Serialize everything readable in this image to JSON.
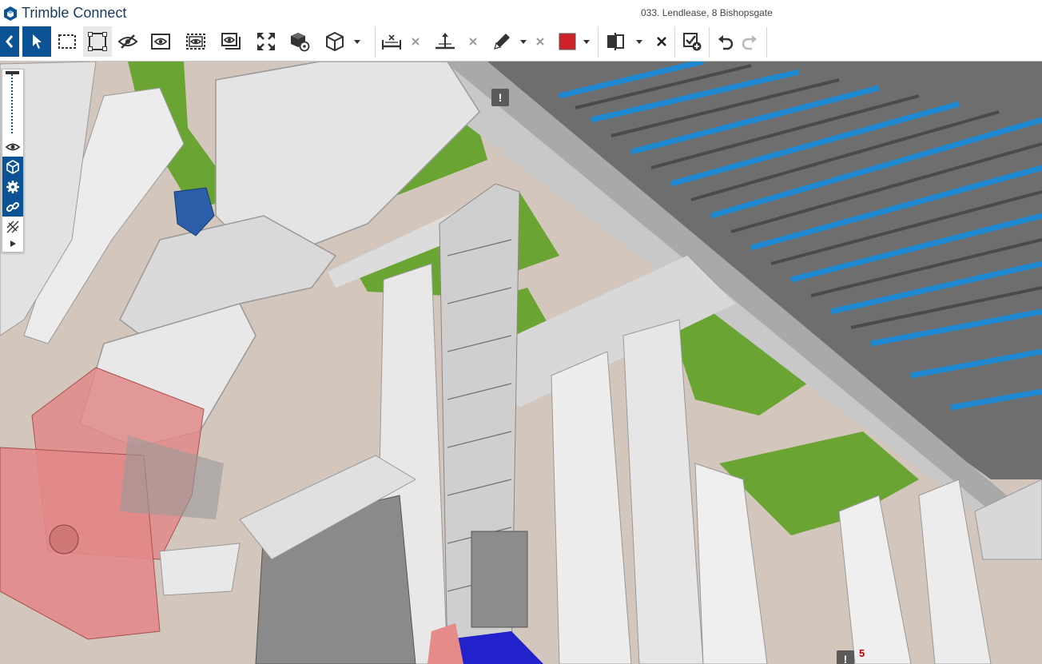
{
  "app": {
    "name": "Trimble Connect",
    "project_title": "033. Lendlease, 8 Bishopsgate"
  },
  "toolbar": {
    "buttons": [
      {
        "id": "back",
        "icon": "chevron-left-icon"
      },
      {
        "id": "select",
        "icon": "pointer-icon"
      },
      {
        "id": "box-select",
        "icon": "dashed-rectangle-icon"
      },
      {
        "id": "fit-select",
        "icon": "corner-brackets-icon"
      },
      {
        "id": "hide",
        "icon": "eye-slash-icon"
      },
      {
        "id": "isolate",
        "icon": "eye-frame-icon"
      },
      {
        "id": "isolate-dashed",
        "icon": "eye-dashed-frame-icon"
      },
      {
        "id": "show-all",
        "icon": "eye-stack-icon"
      },
      {
        "id": "fit-view",
        "icon": "expand-arrows-icon"
      },
      {
        "id": "object-properties",
        "icon": "cube-gear-icon"
      },
      {
        "id": "view-cube",
        "icon": "cube-outline-icon"
      },
      {
        "id": "measure-distance",
        "icon": "measure-distance-icon"
      },
      {
        "id": "measure-point",
        "icon": "measure-point-icon"
      },
      {
        "id": "markup-pencil",
        "icon": "pencil-icon"
      },
      {
        "id": "markup-color",
        "icon": "color-swatch-icon"
      },
      {
        "id": "section-plane",
        "icon": "section-plane-icon"
      },
      {
        "id": "clear-section",
        "icon": "close-icon"
      },
      {
        "id": "create-todo",
        "icon": "checklist-add-icon"
      },
      {
        "id": "undo",
        "icon": "undo-icon"
      },
      {
        "id": "redo",
        "icon": "redo-icon"
      }
    ],
    "markup_color": "#d0202a"
  },
  "side_panel": {
    "buttons": [
      {
        "icon": "eye-icon"
      },
      {
        "icon": "cube-icon"
      },
      {
        "icon": "gear-icon"
      },
      {
        "icon": "link-icon"
      },
      {
        "icon": "laser-icon"
      },
      {
        "icon": "expand-right-icon"
      }
    ]
  },
  "markers": {
    "top_marker": "!",
    "bottom_marker": "!",
    "bottom_count": "5"
  },
  "colors": {
    "brand": "#0b5394",
    "green": "#6aa533",
    "blue_deck": "#1e88d0",
    "red_box": "#e28a8a"
  }
}
